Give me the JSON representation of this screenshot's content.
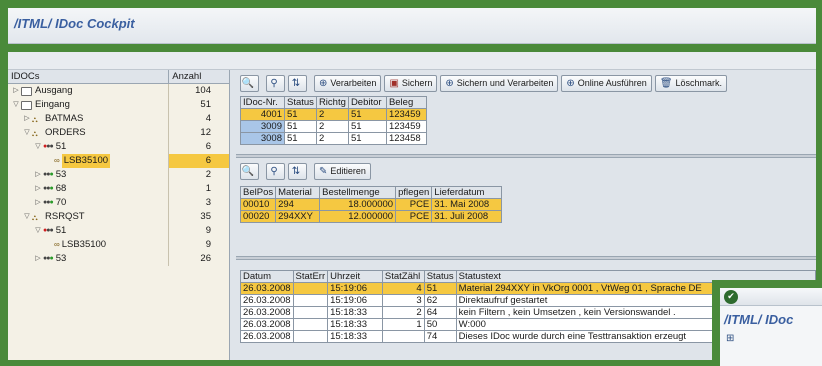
{
  "app": {
    "title": "/ITML/ IDoc Cockpit"
  },
  "tree": {
    "col_idocs": "IDOCs",
    "col_anzahl": "Anzahl",
    "rows": [
      {
        "label": "Ausgang",
        "count": "104",
        "level": 0,
        "exp": "▷",
        "icon": "folder"
      },
      {
        "label": "Eingang",
        "count": "51",
        "level": 0,
        "exp": "▽",
        "icon": "folder"
      },
      {
        "label": "BATMAS",
        "count": "4",
        "level": 1,
        "exp": "▷",
        "icon": "msgtype"
      },
      {
        "label": "ORDERS",
        "count": "12",
        "level": 1,
        "exp": "▽",
        "icon": "msgtype"
      },
      {
        "label": "51",
        "count": "6",
        "level": 2,
        "exp": "▽",
        "icon": "red-light"
      },
      {
        "label": "LSB35100",
        "count": "6",
        "level": 3,
        "exp": "",
        "icon": "glasses",
        "highlight": true
      },
      {
        "label": "53",
        "count": "2",
        "level": 2,
        "exp": "▷",
        "icon": "green-light"
      },
      {
        "label": "68",
        "count": "1",
        "level": 2,
        "exp": "▷",
        "icon": "green-light"
      },
      {
        "label": "70",
        "count": "3",
        "level": 2,
        "exp": "▷",
        "icon": "green-light"
      },
      {
        "label": "RSRQST",
        "count": "35",
        "level": 1,
        "exp": "▽",
        "icon": "msgtype"
      },
      {
        "label": "51",
        "count": "9",
        "level": 2,
        "exp": "▽",
        "icon": "red-light"
      },
      {
        "label": "LSB35100",
        "count": "9",
        "level": 3,
        "exp": "",
        "icon": "glasses"
      },
      {
        "label": "53",
        "count": "26",
        "level": 2,
        "exp": "▷",
        "icon": "green-light"
      }
    ]
  },
  "toolbar1": {
    "verarbeiten": "Verarbeiten",
    "sichern": "Sichern",
    "sichern_verarbeiten": "Sichern und Verarbeiten",
    "online": "Online Ausführen",
    "loeschmark": "Löschmark."
  },
  "idoc_table": {
    "headers": [
      "IDoc-Nr.",
      "Status",
      "Richtg",
      "Debitor",
      "Beleg"
    ],
    "rows": [
      [
        "4001",
        "51",
        "2",
        "51",
        "123459"
      ],
      [
        "3009",
        "51",
        "2",
        "51",
        "123459"
      ],
      [
        "3008",
        "51",
        "2",
        "51",
        "123458"
      ]
    ]
  },
  "toolbar2": {
    "editieren": "Editieren"
  },
  "pos_table": {
    "headers": [
      "BelPos",
      "Material",
      "Bestellmenge",
      "pflegen",
      "Lieferdatum"
    ],
    "rows": [
      [
        "00010",
        "294",
        "18.000000",
        "PCE",
        "31. Mai 2008"
      ],
      [
        "00020",
        "294XXY",
        "12.000000",
        "PCE",
        "31. Juli 2008"
      ]
    ]
  },
  "status_table": {
    "headers": [
      "Datum",
      "StatErr",
      "Uhrzeit",
      "StatZähl",
      "Status",
      "Statustext"
    ],
    "rows": [
      [
        "26.03.2008",
        "",
        "15:19:06",
        "4",
        "51",
        "Material 294XXY in VkOrg 0001 , VtWeg 01 , Sprache DE"
      ],
      [
        "26.03.2008",
        "",
        "15:19:06",
        "3",
        "62",
        "Direktaufruf gestartet"
      ],
      [
        "26.03.2008",
        "",
        "15:18:33",
        "2",
        "64",
        "kein Filtern , kein Umsetzen , kein Versionswandel ."
      ],
      [
        "26.03.2008",
        "",
        "15:18:33",
        "1",
        "50",
        "W:000"
      ],
      [
        "26.03.2008",
        "",
        "15:18:33",
        "",
        "74",
        "Dieses IDoc wurde durch eine Testtransaktion erzeugt"
      ]
    ]
  },
  "overlay": {
    "title": "/ITML/ IDoc"
  }
}
